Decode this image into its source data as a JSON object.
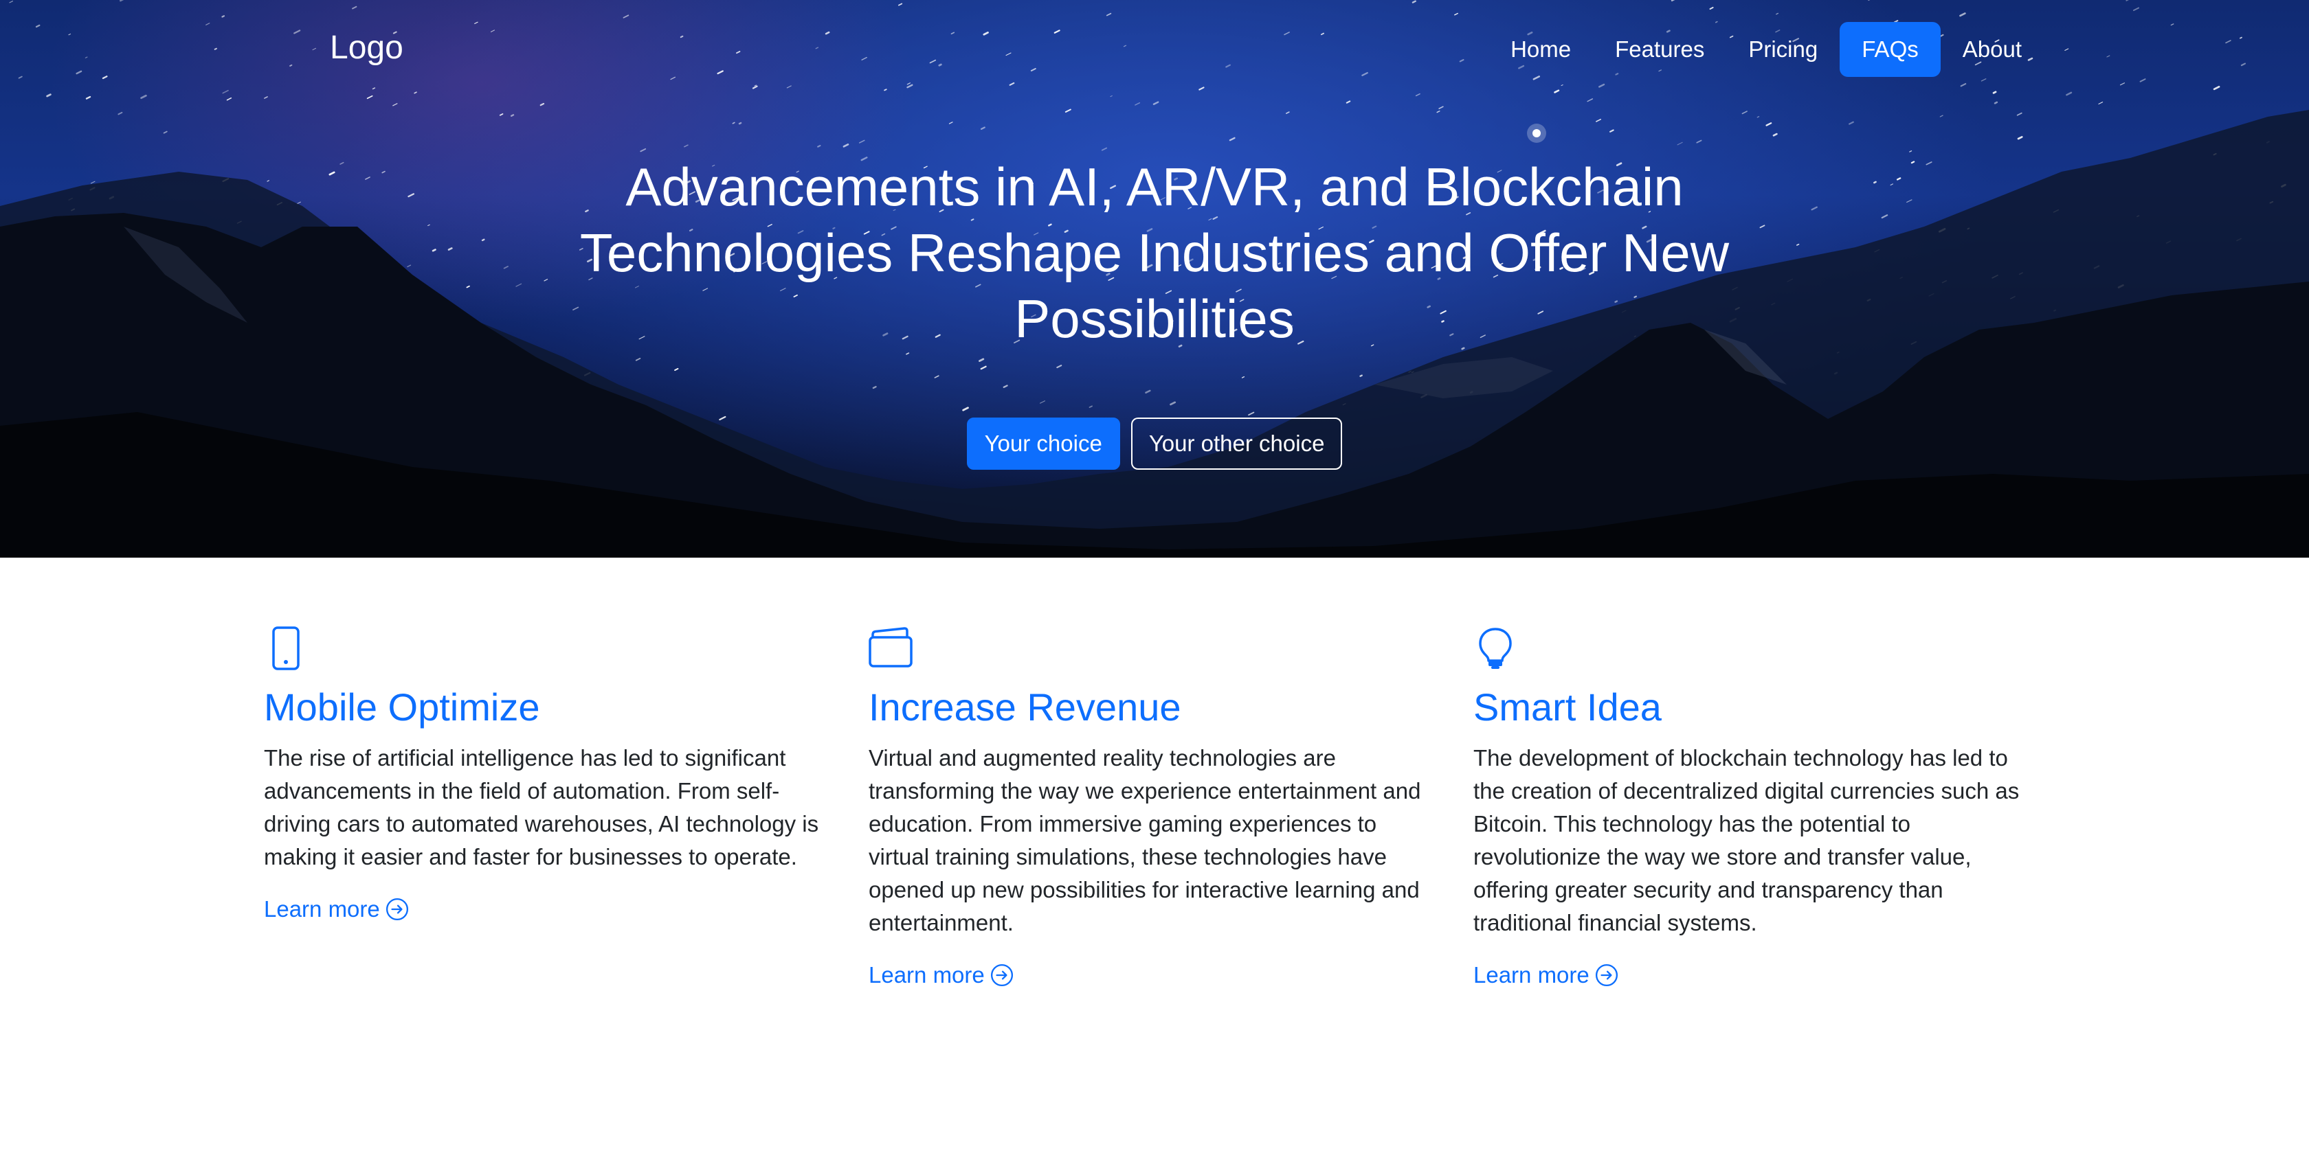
{
  "nav": {
    "logo": "Logo",
    "items": [
      {
        "label": "Home",
        "active": false
      },
      {
        "label": "Features",
        "active": false
      },
      {
        "label": "Pricing",
        "active": false
      },
      {
        "label": "FAQs",
        "active": true
      },
      {
        "label": "About",
        "active": false
      }
    ]
  },
  "hero": {
    "title_lines": [
      "Advancements in AI, AR/VR, and Blockchain",
      "Technologies Reshape Industries and Offer New",
      "Possibilities"
    ],
    "primary_button": "Your choice",
    "secondary_button": "Your other choice"
  },
  "features": [
    {
      "icon": "phone-icon",
      "title": "Mobile Optimize",
      "text": "The rise of artificial intelligence has led to significant advancements in the field of automation. From self-driving cars to automated warehouses, AI technology is making it easier and faster for businesses to operate.",
      "link": "Learn more"
    },
    {
      "icon": "wallet-icon",
      "title": "Increase Revenue",
      "text": "Virtual and augmented reality technologies are transforming the way we experience entertainment and education. From immersive gaming experiences to virtual training simulations, these technologies have opened up new possibilities for interactive learning and entertainment.",
      "link": "Learn more"
    },
    {
      "icon": "lightbulb-icon",
      "title": "Smart Idea",
      "text": "The development of blockchain technology has led to the creation of decentralized digital currencies such as Bitcoin. This technology has the potential to revolutionize the way we store and transfer value, offering greater security and transparency than traditional financial systems.",
      "link": "Learn more"
    }
  ],
  "colors": {
    "accent": "#0d6efd",
    "text": "#212529",
    "hero_sky": "#15348a"
  }
}
